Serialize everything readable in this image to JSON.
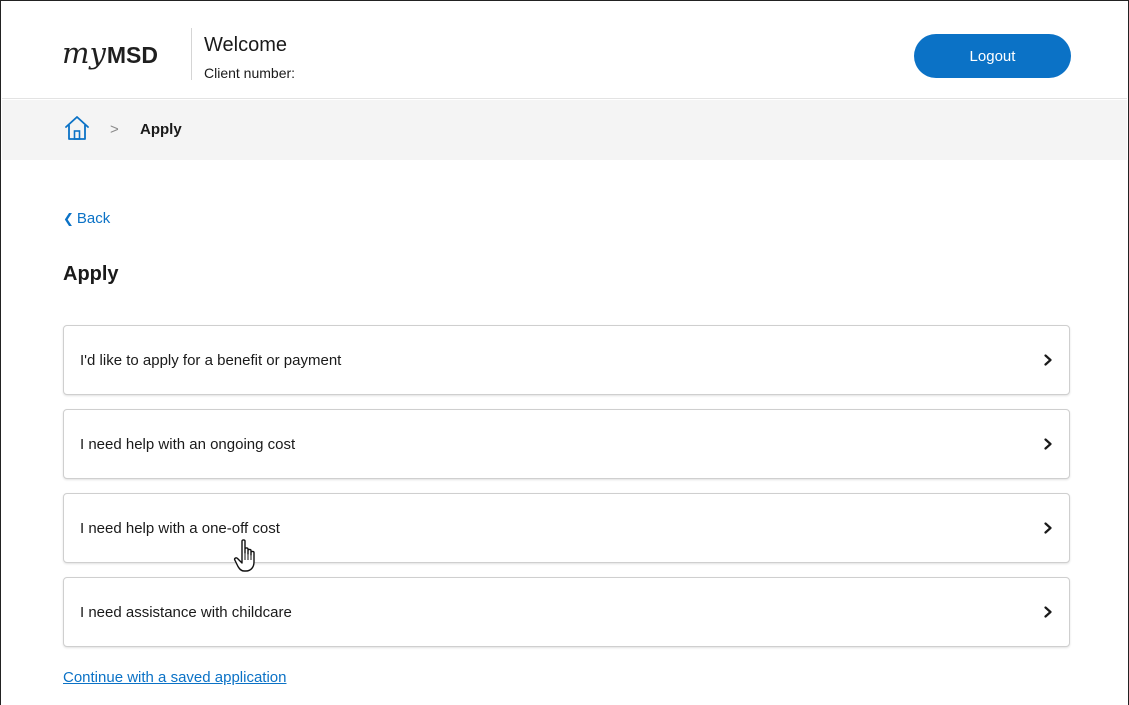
{
  "header": {
    "logo_my": "my",
    "logo_msd": "MSD",
    "welcome": "Welcome",
    "client_number": "Client number:",
    "logout_label": "Logout"
  },
  "breadcrumb": {
    "home_icon": "home-icon",
    "separator": ">",
    "current": "Apply"
  },
  "main": {
    "back_label": "Back",
    "title": "Apply",
    "options": [
      {
        "label": "I'd like to apply for a benefit or payment",
        "icon": "chevron-right-icon"
      },
      {
        "label": "I need help with an ongoing cost",
        "icon": "chevron-right-icon"
      },
      {
        "label": "I need help with a one-off cost",
        "icon": "chevron-right-icon"
      },
      {
        "label": "I need assistance with childcare",
        "icon": "chevron-right-icon"
      }
    ],
    "saved_link": "Continue with a saved application"
  },
  "colors": {
    "accent": "#0b72c6",
    "breadcrumb_bg": "#f4f4f4",
    "text": "#1a1a1a"
  }
}
